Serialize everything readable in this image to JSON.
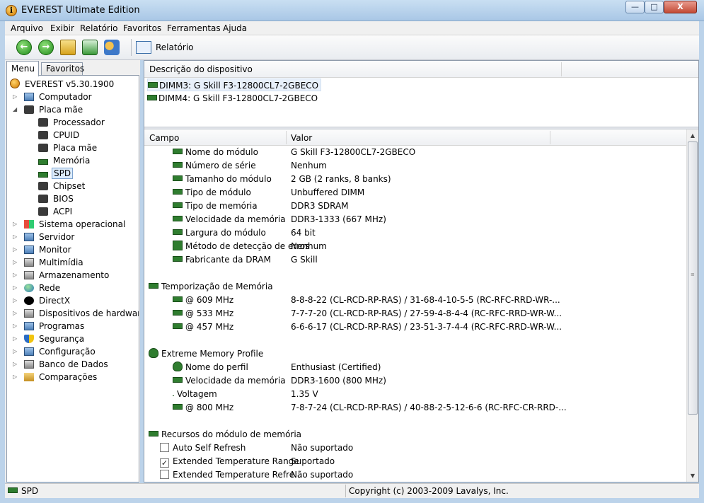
{
  "window": {
    "title": "EVEREST Ultimate Edition",
    "minimize": "—",
    "maximize": "□",
    "close": "X"
  },
  "menubar": [
    "Arquivo",
    "Exibir",
    "Relatório",
    "Favoritos",
    "Ferramentas",
    "Ajuda"
  ],
  "toolbar": {
    "back_icon": "back-arrow-icon",
    "forward_icon": "forward-arrow-icon",
    "up_icon": "up-folder-icon",
    "refresh_icon": "refresh-icon",
    "users_icon": "users-icon",
    "report_label": "Relatório"
  },
  "left_tabs": {
    "menu": "Menu",
    "favorites": "Favoritos"
  },
  "tree": [
    {
      "label": "EVEREST v5.30.1900",
      "icon": "info-icon"
    },
    {
      "label": "Computador",
      "icon": "computer-icon"
    },
    {
      "label": "Placa mãe",
      "icon": "motherboard-icon"
    },
    {
      "label": "Processador",
      "icon": "processor-icon"
    },
    {
      "label": "CPUID",
      "icon": "cpuid-icon"
    },
    {
      "label": "Placa mãe",
      "icon": "motherboard-icon"
    },
    {
      "label": "Memória",
      "icon": "memory-icon"
    },
    {
      "label": "SPD",
      "icon": "memory-icon"
    },
    {
      "label": "Chipset",
      "icon": "chipset-icon"
    },
    {
      "label": "BIOS",
      "icon": "bios-icon"
    },
    {
      "label": "ACPI",
      "icon": "acpi-icon"
    },
    {
      "label": "Sistema operacional",
      "icon": "windows-icon"
    },
    {
      "label": "Servidor",
      "icon": "server-icon"
    },
    {
      "label": "Monitor",
      "icon": "monitor-icon"
    },
    {
      "label": "Multimídia",
      "icon": "multimedia-icon"
    },
    {
      "label": "Armazenamento",
      "icon": "storage-icon"
    },
    {
      "label": "Rede",
      "icon": "network-icon"
    },
    {
      "label": "DirectX",
      "icon": "directx-icon"
    },
    {
      "label": "Dispositivos de hardware",
      "icon": "hardware-icon"
    },
    {
      "label": "Programas",
      "icon": "programs-icon"
    },
    {
      "label": "Segurança",
      "icon": "security-icon"
    },
    {
      "label": "Configuração",
      "icon": "config-icon"
    },
    {
      "label": "Banco de Dados",
      "icon": "database-icon"
    },
    {
      "label": "Comparações",
      "icon": "hourglass-icon"
    }
  ],
  "device_panel": {
    "header": "Descrição do dispositivo",
    "items": [
      "DIMM3: G Skill F3-12800CL7-2GBECO",
      "DIMM4: G Skill F3-12800CL7-2GBECO"
    ]
  },
  "grid": {
    "col_field": "Campo",
    "col_value": "Valor",
    "module": [
      {
        "field": "Nome do módulo",
        "value": "G Skill F3-12800CL7-2GBECO"
      },
      {
        "field": "Número de série",
        "value": "Nenhum"
      },
      {
        "field": "Tamanho do módulo",
        "value": "2 GB (2 ranks, 8 banks)"
      },
      {
        "field": "Tipo de módulo",
        "value": "Unbuffered DIMM"
      },
      {
        "field": "Tipo de memória",
        "value": "DDR3 SDRAM"
      },
      {
        "field": "Velocidade da memória",
        "value": "DDR3-1333 (667 MHz)"
      },
      {
        "field": "Largura do módulo",
        "value": "64 bit"
      },
      {
        "field": "Método de detecção de erros",
        "value": "Nenhum"
      },
      {
        "field": "Fabricante da DRAM",
        "value": "G Skill"
      }
    ],
    "timing_section": "Temporização de Memória",
    "timings": [
      {
        "field": "@ 609 MHz",
        "value": "8-8-8-22  (CL-RCD-RP-RAS) / 31-68-4-10-5-5  (RC-RFC-RRD-WR-..."
      },
      {
        "field": "@ 533 MHz",
        "value": "7-7-7-20  (CL-RCD-RP-RAS) / 27-59-4-8-4-4  (RC-RFC-RRD-WR-W..."
      },
      {
        "field": "@ 457 MHz",
        "value": "6-6-6-17  (CL-RCD-RP-RAS) / 23-51-3-7-4-4  (RC-RFC-RRD-WR-W..."
      }
    ],
    "xmp_section": "Extreme Memory Profile",
    "xmp": [
      {
        "field": "Nome do perfil",
        "value": "Enthusiast (Certified)",
        "icon": "flame-icon"
      },
      {
        "field": "Velocidade da memória",
        "value": "DDR3-1600 (800 MHz)",
        "icon": "memory-icon"
      },
      {
        "field": "Voltagem",
        "value": "1.35 V",
        "icon": "warning-icon"
      },
      {
        "field": "@ 800 MHz",
        "value": "7-8-7-24  (CL-RCD-RP-RAS) / 40-88-2-5-12-6-6  (RC-RFC-CR-RRD-...",
        "icon": "memory-icon"
      }
    ],
    "features_section": "Recursos do módulo de memória",
    "features": [
      {
        "field": "Auto Self Refresh",
        "value": "Não suportado",
        "checked": false
      },
      {
        "field": "Extended Temperature Range",
        "value": "Suportado",
        "checked": true
      },
      {
        "field": "Extended Temperature Refre...",
        "value": "Não suportado",
        "checked": false
      }
    ]
  },
  "statusbar": {
    "left": "SPD",
    "right": "Copyright (c) 2003-2009 Lavalys, Inc."
  }
}
